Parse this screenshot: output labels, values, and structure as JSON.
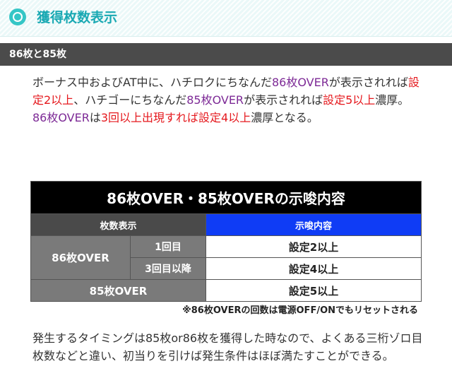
{
  "header": {
    "title": "獲得枚数表示"
  },
  "section": {
    "title": "86枚と85枚"
  },
  "intro": {
    "s1": "ボーナス中およびAT中に、ハチロクにちなんだ",
    "s2": "86枚OVER",
    "s3": "が表示されれば",
    "s4": "設定2以上",
    "s5": "、ハチゴーにちなんだ",
    "s6": "85枚OVER",
    "s7": "が表示されれば",
    "s8": "設定5以上",
    "s9": "濃厚。",
    "s10": "86枚OVER",
    "s11": "は",
    "s12": "3回以上出現すれば設定4以上",
    "s13": "濃厚となる。"
  },
  "table": {
    "title": "86枚OVER・85枚OVERの示唆内容",
    "col_left": "枚数表示",
    "col_right": "示唆内容",
    "rows": [
      {
        "category": "86枚OVER",
        "sub": "1回目",
        "value": "設定2以上"
      },
      {
        "sub": "3回目以降",
        "value": "設定4以上"
      },
      {
        "category": "85枚OVER",
        "value": "設定5以上"
      }
    ]
  },
  "note": "※86枚OVERの回数は電源OFF/ONでもリセットされる",
  "outro": "発生するタイミングは85枚or86枚を獲得した時なので、よくある三桁ゾロ目枚数などと違い、初当りを引けば発生条件はほぼ満たすことができる。",
  "colors": {
    "accent": "#1aa9b3",
    "purple": "#7d2a96",
    "red": "#e5191e",
    "table_blue": "#0f3cf5"
  }
}
